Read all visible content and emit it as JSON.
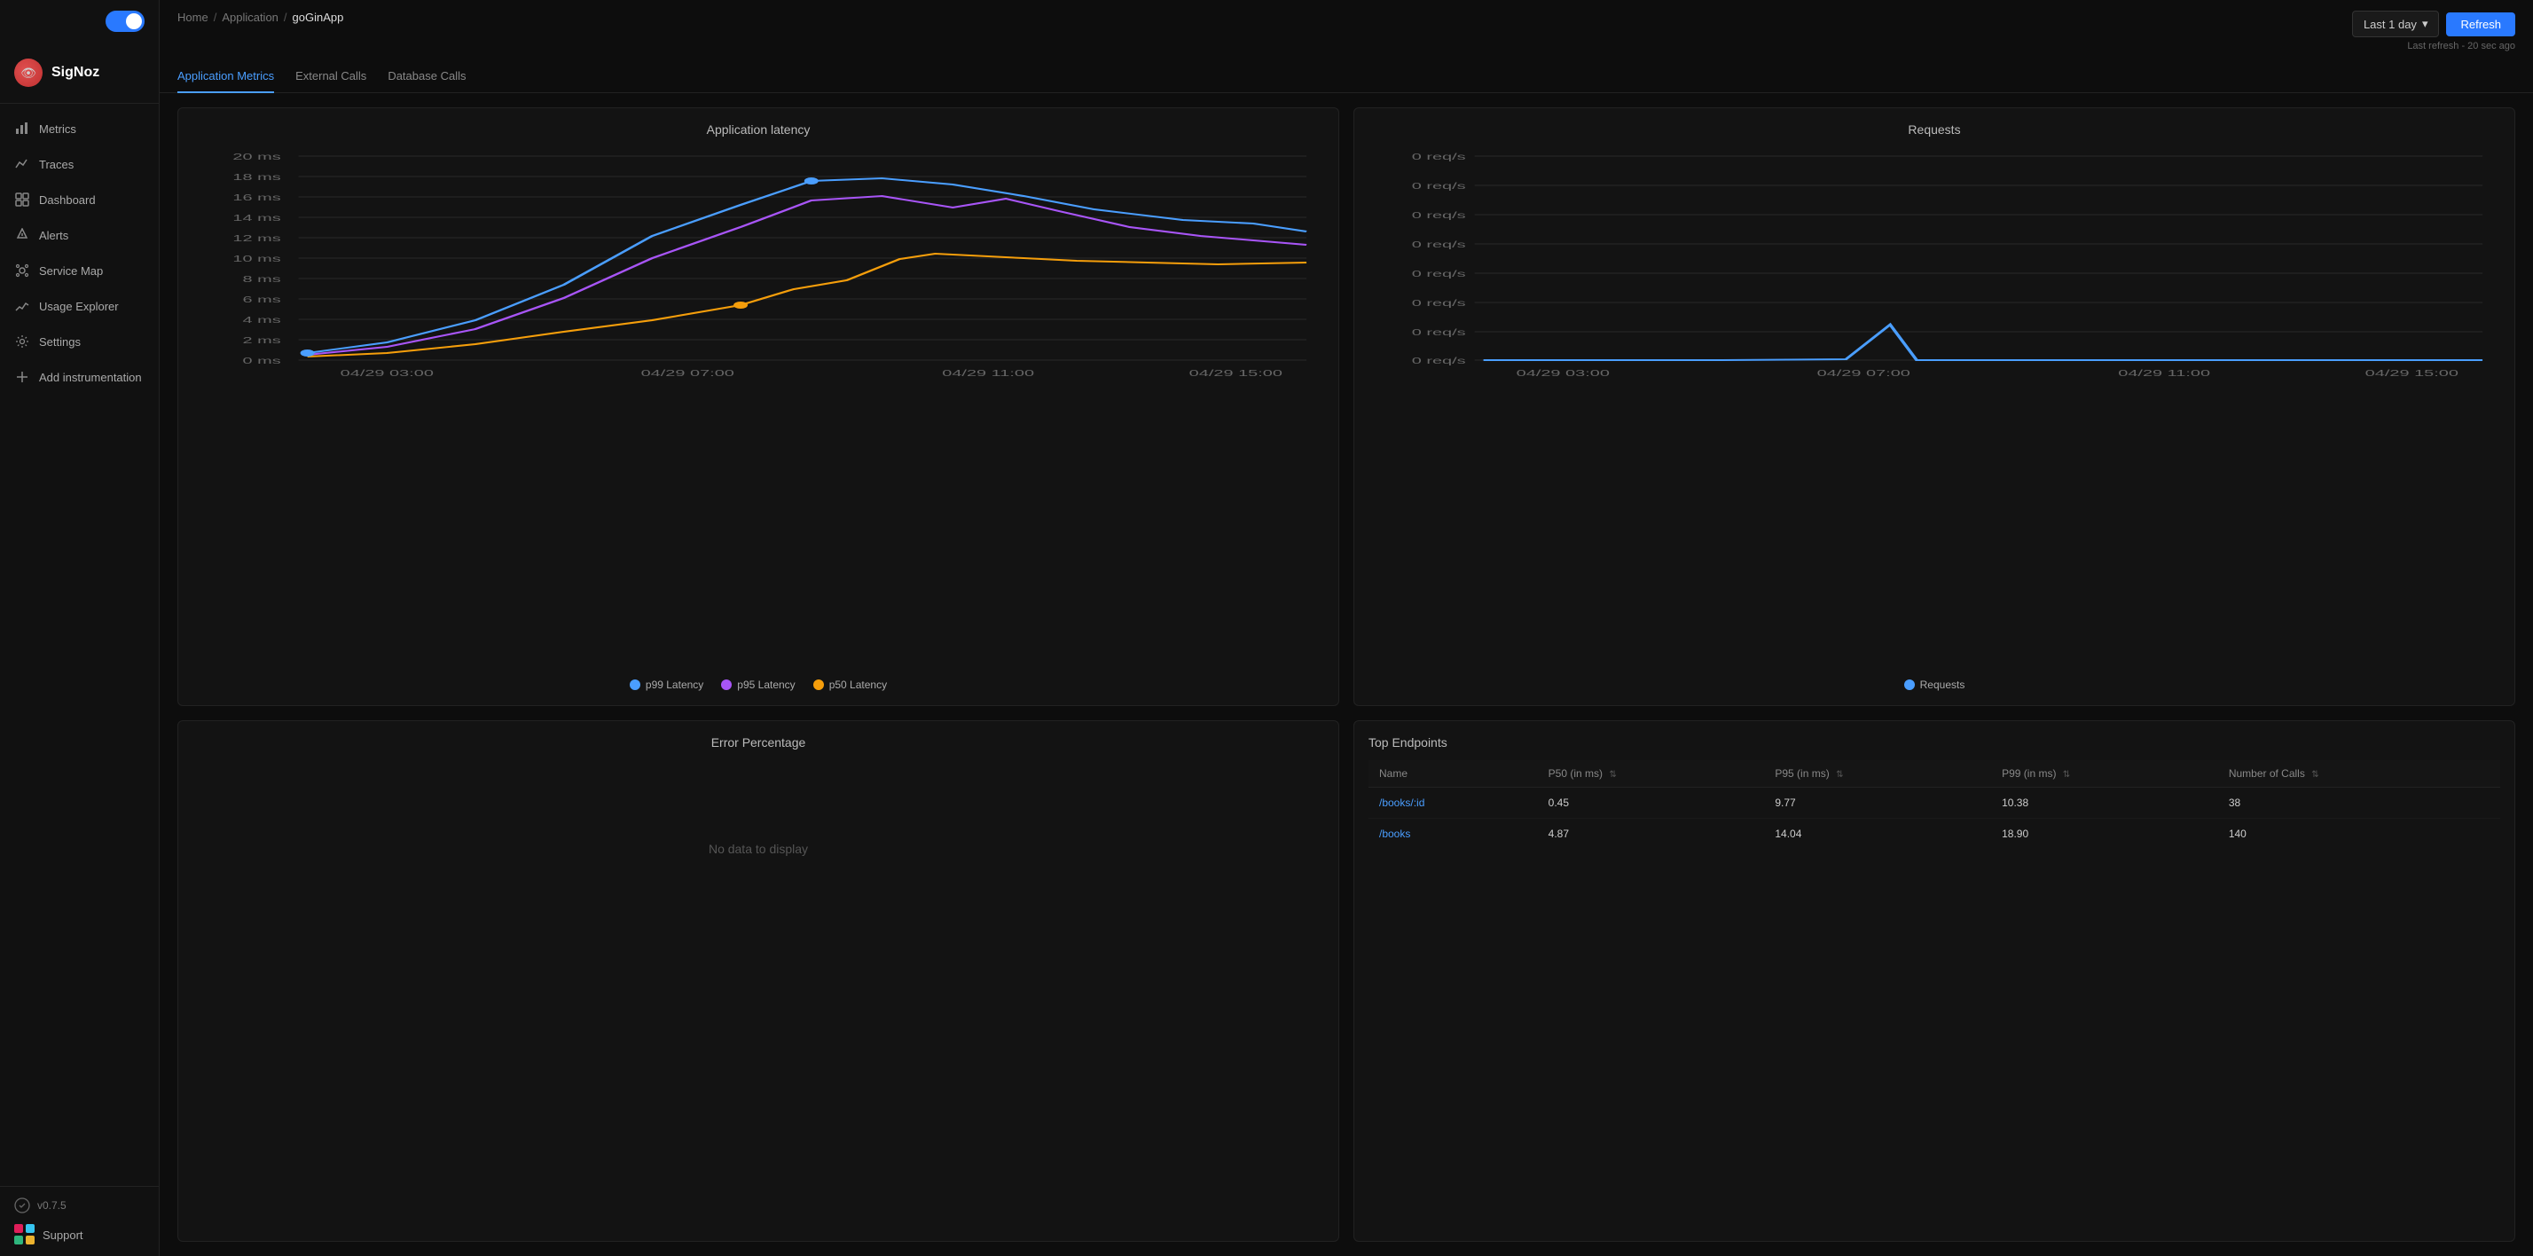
{
  "app": {
    "name": "SigNoz"
  },
  "sidebar": {
    "items": [
      {
        "id": "metrics",
        "label": "Metrics",
        "icon": "📊"
      },
      {
        "id": "traces",
        "label": "Traces",
        "icon": "📈"
      },
      {
        "id": "dashboard",
        "label": "Dashboard",
        "icon": "🔲"
      },
      {
        "id": "alerts",
        "label": "Alerts",
        "icon": "🔔"
      },
      {
        "id": "service-map",
        "label": "Service Map",
        "icon": "🗺"
      },
      {
        "id": "usage-explorer",
        "label": "Usage Explorer",
        "icon": "📉"
      },
      {
        "id": "settings",
        "label": "Settings",
        "icon": "⚙"
      },
      {
        "id": "add-instrumentation",
        "label": "Add instrumentation",
        "icon": "➕"
      }
    ],
    "version": "v0.7.5",
    "support": "Support"
  },
  "breadcrumb": {
    "home": "Home",
    "application": "Application",
    "current": "goGinApp",
    "sep": "/"
  },
  "topbar": {
    "time_selector": "Last 1 day",
    "refresh_label": "Refresh",
    "last_refresh": "Last refresh - 20 sec ago"
  },
  "tabs": [
    {
      "id": "application-metrics",
      "label": "Application Metrics",
      "active": true
    },
    {
      "id": "external-calls",
      "label": "External Calls",
      "active": false
    },
    {
      "id": "database-calls",
      "label": "Database Calls",
      "active": false
    }
  ],
  "latency_chart": {
    "title": "Application latency",
    "y_labels": [
      "20 ms",
      "18 ms",
      "16 ms",
      "14 ms",
      "12 ms",
      "10 ms",
      "8 ms",
      "6 ms",
      "4 ms",
      "2 ms",
      "0 ms"
    ],
    "x_labels": [
      "04/29 03:00",
      "04/29 07:00",
      "04/29 11:00",
      "04/29 15:00"
    ],
    "legend": [
      {
        "id": "p99",
        "label": "p99 Latency",
        "color": "#4a9eff"
      },
      {
        "id": "p95",
        "label": "p95 Latency",
        "color": "#a855f7"
      },
      {
        "id": "p50",
        "label": "p50 Latency",
        "color": "#f59e0b"
      }
    ]
  },
  "requests_chart": {
    "title": "Requests",
    "y_labels": [
      "0 req/s",
      "0 req/s",
      "0 req/s",
      "0 req/s",
      "0 req/s",
      "0 req/s",
      "0 req/s",
      "0 req/s"
    ],
    "x_labels": [
      "04/29 03:00",
      "04/29 07:00",
      "04/29 11:00",
      "04/29 15:00"
    ],
    "legend": [
      {
        "id": "requests",
        "label": "Requests",
        "color": "#4a9eff"
      }
    ]
  },
  "error_chart": {
    "title": "Error Percentage",
    "no_data": "No data to display"
  },
  "top_endpoints": {
    "title": "Top Endpoints",
    "columns": [
      {
        "id": "name",
        "label": "Name"
      },
      {
        "id": "p50",
        "label": "P50 (in ms)"
      },
      {
        "id": "p95",
        "label": "P95 (in ms)"
      },
      {
        "id": "p99",
        "label": "P99 (in ms)"
      },
      {
        "id": "calls",
        "label": "Number of Calls"
      }
    ],
    "rows": [
      {
        "name": "/books/:id",
        "p50": "0.45",
        "p95": "9.77",
        "p99": "10.38",
        "calls": "38"
      },
      {
        "name": "/books",
        "p50": "4.87",
        "p95": "14.04",
        "p99": "18.90",
        "calls": "140"
      }
    ]
  }
}
